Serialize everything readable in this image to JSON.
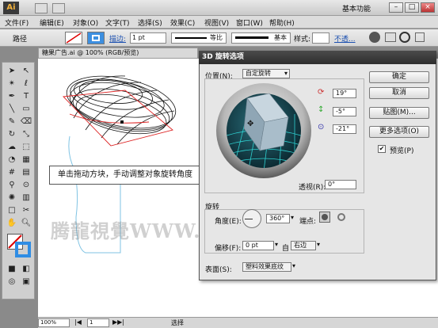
{
  "app": {
    "logo": "Ai",
    "workspace": "基本功能",
    "window_controls": [
      "–",
      "□",
      "×"
    ]
  },
  "menu": [
    "文件(F)",
    "编辑(E)",
    "对象(O)",
    "文字(T)",
    "选择(S)",
    "效果(C)",
    "视图(V)",
    "窗口(W)",
    "帮助(H)"
  ],
  "control_bar": {
    "object_type": "路径",
    "stroke_label": "描边:",
    "stroke_weight": "1 pt",
    "profile_label": "等比",
    "brush_label": "基本",
    "style_label": "样式:",
    "opacity_label": "不透..."
  },
  "document": {
    "tab_title": "糖果广告.ai @ 100% (RGB/预览)",
    "zoom": "100%",
    "page": "1",
    "status": "选择"
  },
  "callout": "单击拖动方块，手动调整对象旋转角度",
  "watermark": "腾龍視覺WWW.TLVI.NET",
  "dialog": {
    "title": "3D 旋转选项",
    "position_label": "位置(N):",
    "position_value": "自定旋转",
    "x_rotation": "19°",
    "y_rotation": "-5°",
    "z_rotation": "-21°",
    "perspective_label": "透视(R):",
    "perspective_value": "0°",
    "shading_group": "旋转",
    "angle_label": "角度(E):",
    "angle_value": "360°",
    "cap_label": "端点:",
    "offset_label": "偏移(F):",
    "offset_value": "0 pt",
    "offset_from_label": "自",
    "offset_from_value": "右边",
    "surface_label": "表面(S):",
    "surface_value": "塑料效果底纹",
    "buttons": {
      "ok": "确定",
      "cancel": "取消",
      "map": "贴图(M)...",
      "more": "更多选项(O)"
    },
    "preview_label": "预览(P)",
    "preview_checked": "✔"
  },
  "colors": {
    "dialog_title_bg": "#3a3a3a",
    "cube_face": "#9fb6c6",
    "sphere_bg": "#1c4a55",
    "grid": "#2fd0d0",
    "accent_blue": "#1a6fd1"
  }
}
